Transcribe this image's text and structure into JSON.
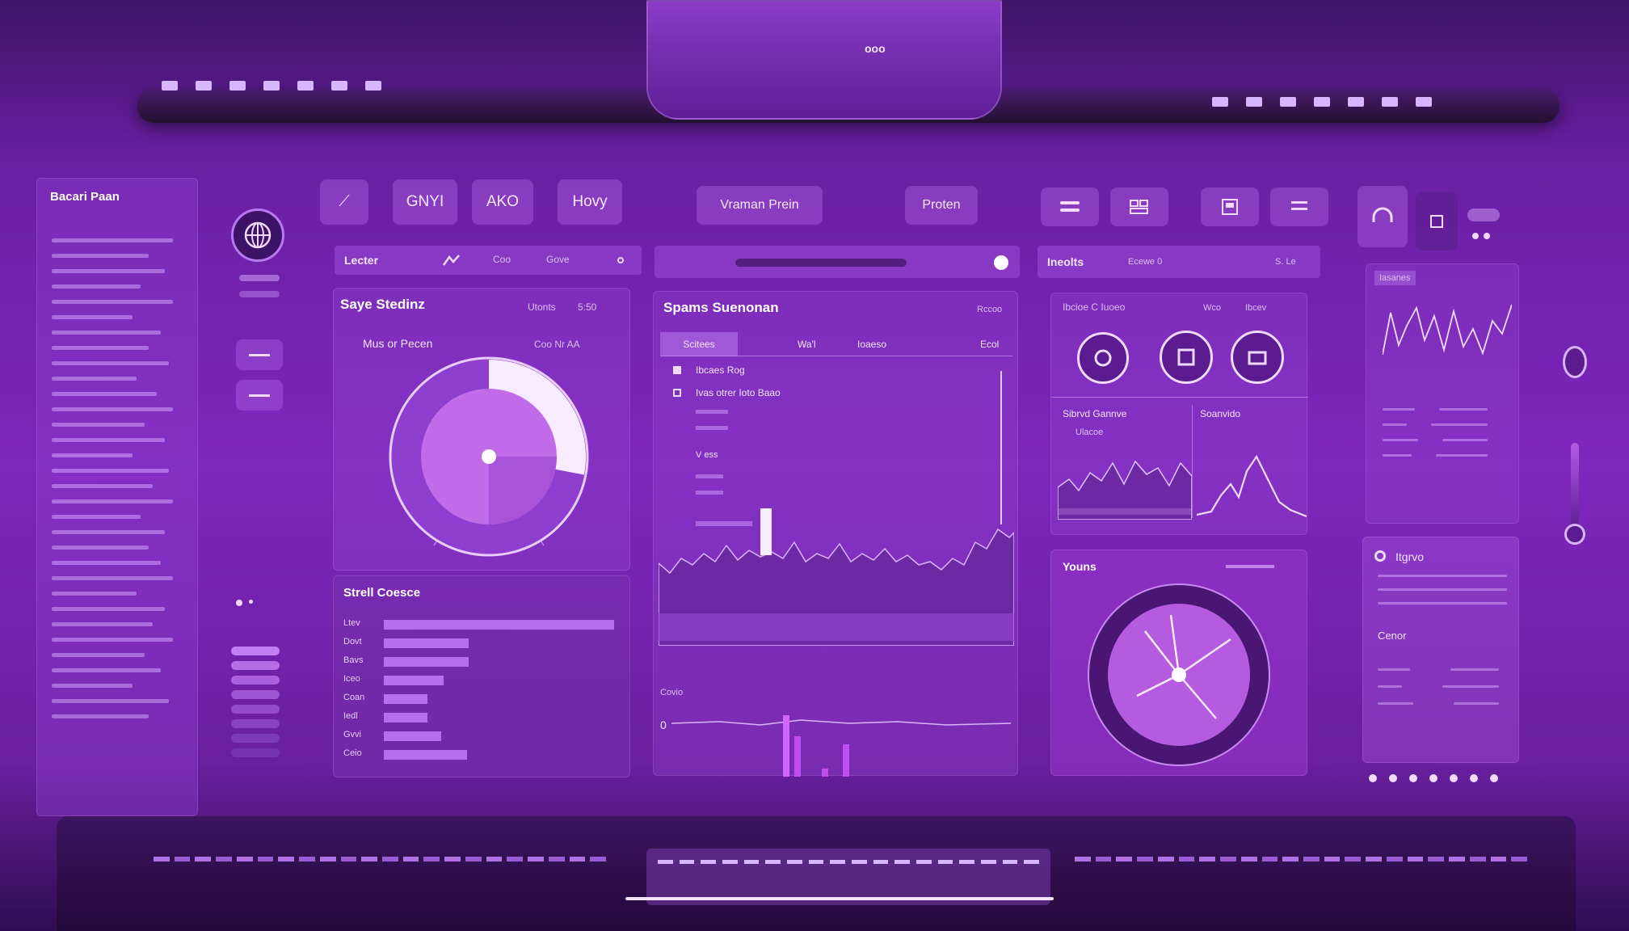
{
  "colors": {
    "accent": "#c985ff",
    "bg": "#7d27bd",
    "bright": "#f2d9ff"
  },
  "top_bar": {
    "label": "ooo"
  },
  "left_panel": {
    "title": "Bacari Paan"
  },
  "toolbar": {
    "tabs": [
      "GNYI",
      "AKO",
      "Hovy"
    ],
    "center_label": "Vraman Prein",
    "right_label": "Proten"
  },
  "panel_a": {
    "header": "Lecter",
    "header_tag": "Coo",
    "header_tag2": "Gove",
    "title": "Saye Stedinz",
    "title_meta": "Utonts",
    "title_meta2": "5:50",
    "donut_label": "Mus or Pecen",
    "donut_meta": "Coo Nr AA",
    "donut_fraction": 0.28,
    "bars_title": "Strell Coesce",
    "bar_labels": [
      "Ltev",
      "Dovt",
      "Bavs",
      "Iceo",
      "Coan",
      "Iedl",
      "Gvvi",
      "Ceio"
    ],
    "bar_values": [
      1.0,
      0.37,
      0.37,
      0.26,
      0.19,
      0.19,
      0.25,
      0.36
    ]
  },
  "panel_b": {
    "title": "Spams Suenonan",
    "title_meta": "Rccoo",
    "tab_active": "Scitees",
    "tab_2": "Wa'l",
    "tab_3": "Ioaeso",
    "tab_4": "Ecol",
    "legend_1": "Ibcaes Rog",
    "legend_2": "Ivas otrer Ioto Baao",
    "legend_3": "V ess",
    "lower_label": "Covio",
    "lower_value": "0"
  },
  "panel_c": {
    "header": "Ineolts",
    "header_tag": "Ecewe 0",
    "header_tag2": "S. Le",
    "subtitle": "Ibcioe C Iuoeo",
    "subtitle_meta": "Wco",
    "subtitle_meta2": "Ibcev",
    "mini_1_title": "Sibrvd Gannve",
    "mini_1_sub": "Ulacoe",
    "mini_2_title": "Soanvido",
    "gauge_title": "Youns"
  },
  "right_panel": {
    "header": "Iasanes",
    "list_title": "Itgrvo",
    "list_title_2": "Cenor"
  }
}
